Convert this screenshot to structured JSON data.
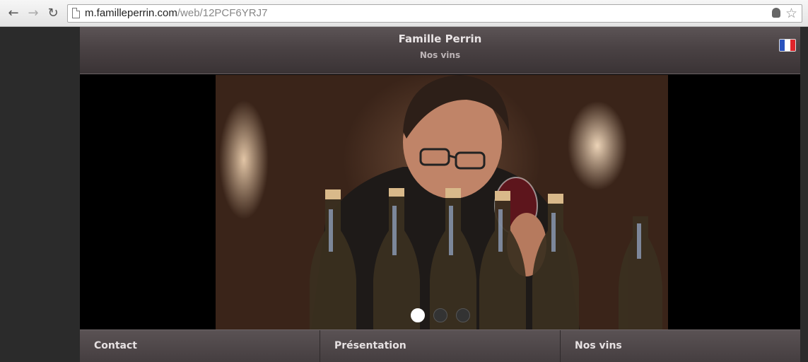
{
  "browser": {
    "url_host": "m.familleperrin.com",
    "url_path": "/web/12PCF6YRJ7",
    "back_icon": "←",
    "forward_icon": "→",
    "reload_icon": "↻",
    "star_icon": "☆"
  },
  "header": {
    "title": "Famille Perrin",
    "subtitle": "Nos vins"
  },
  "carousel": {
    "slide_count": 3,
    "active_index": 0
  },
  "menu": {
    "items": [
      {
        "label": "Contact"
      },
      {
        "label": "Présentation"
      },
      {
        "label": "Nos vins"
      }
    ]
  },
  "colors": {
    "header_bg": "#4a4244",
    "menu_bg": "#4e4749",
    "page_bg": "#2b2b2b"
  }
}
